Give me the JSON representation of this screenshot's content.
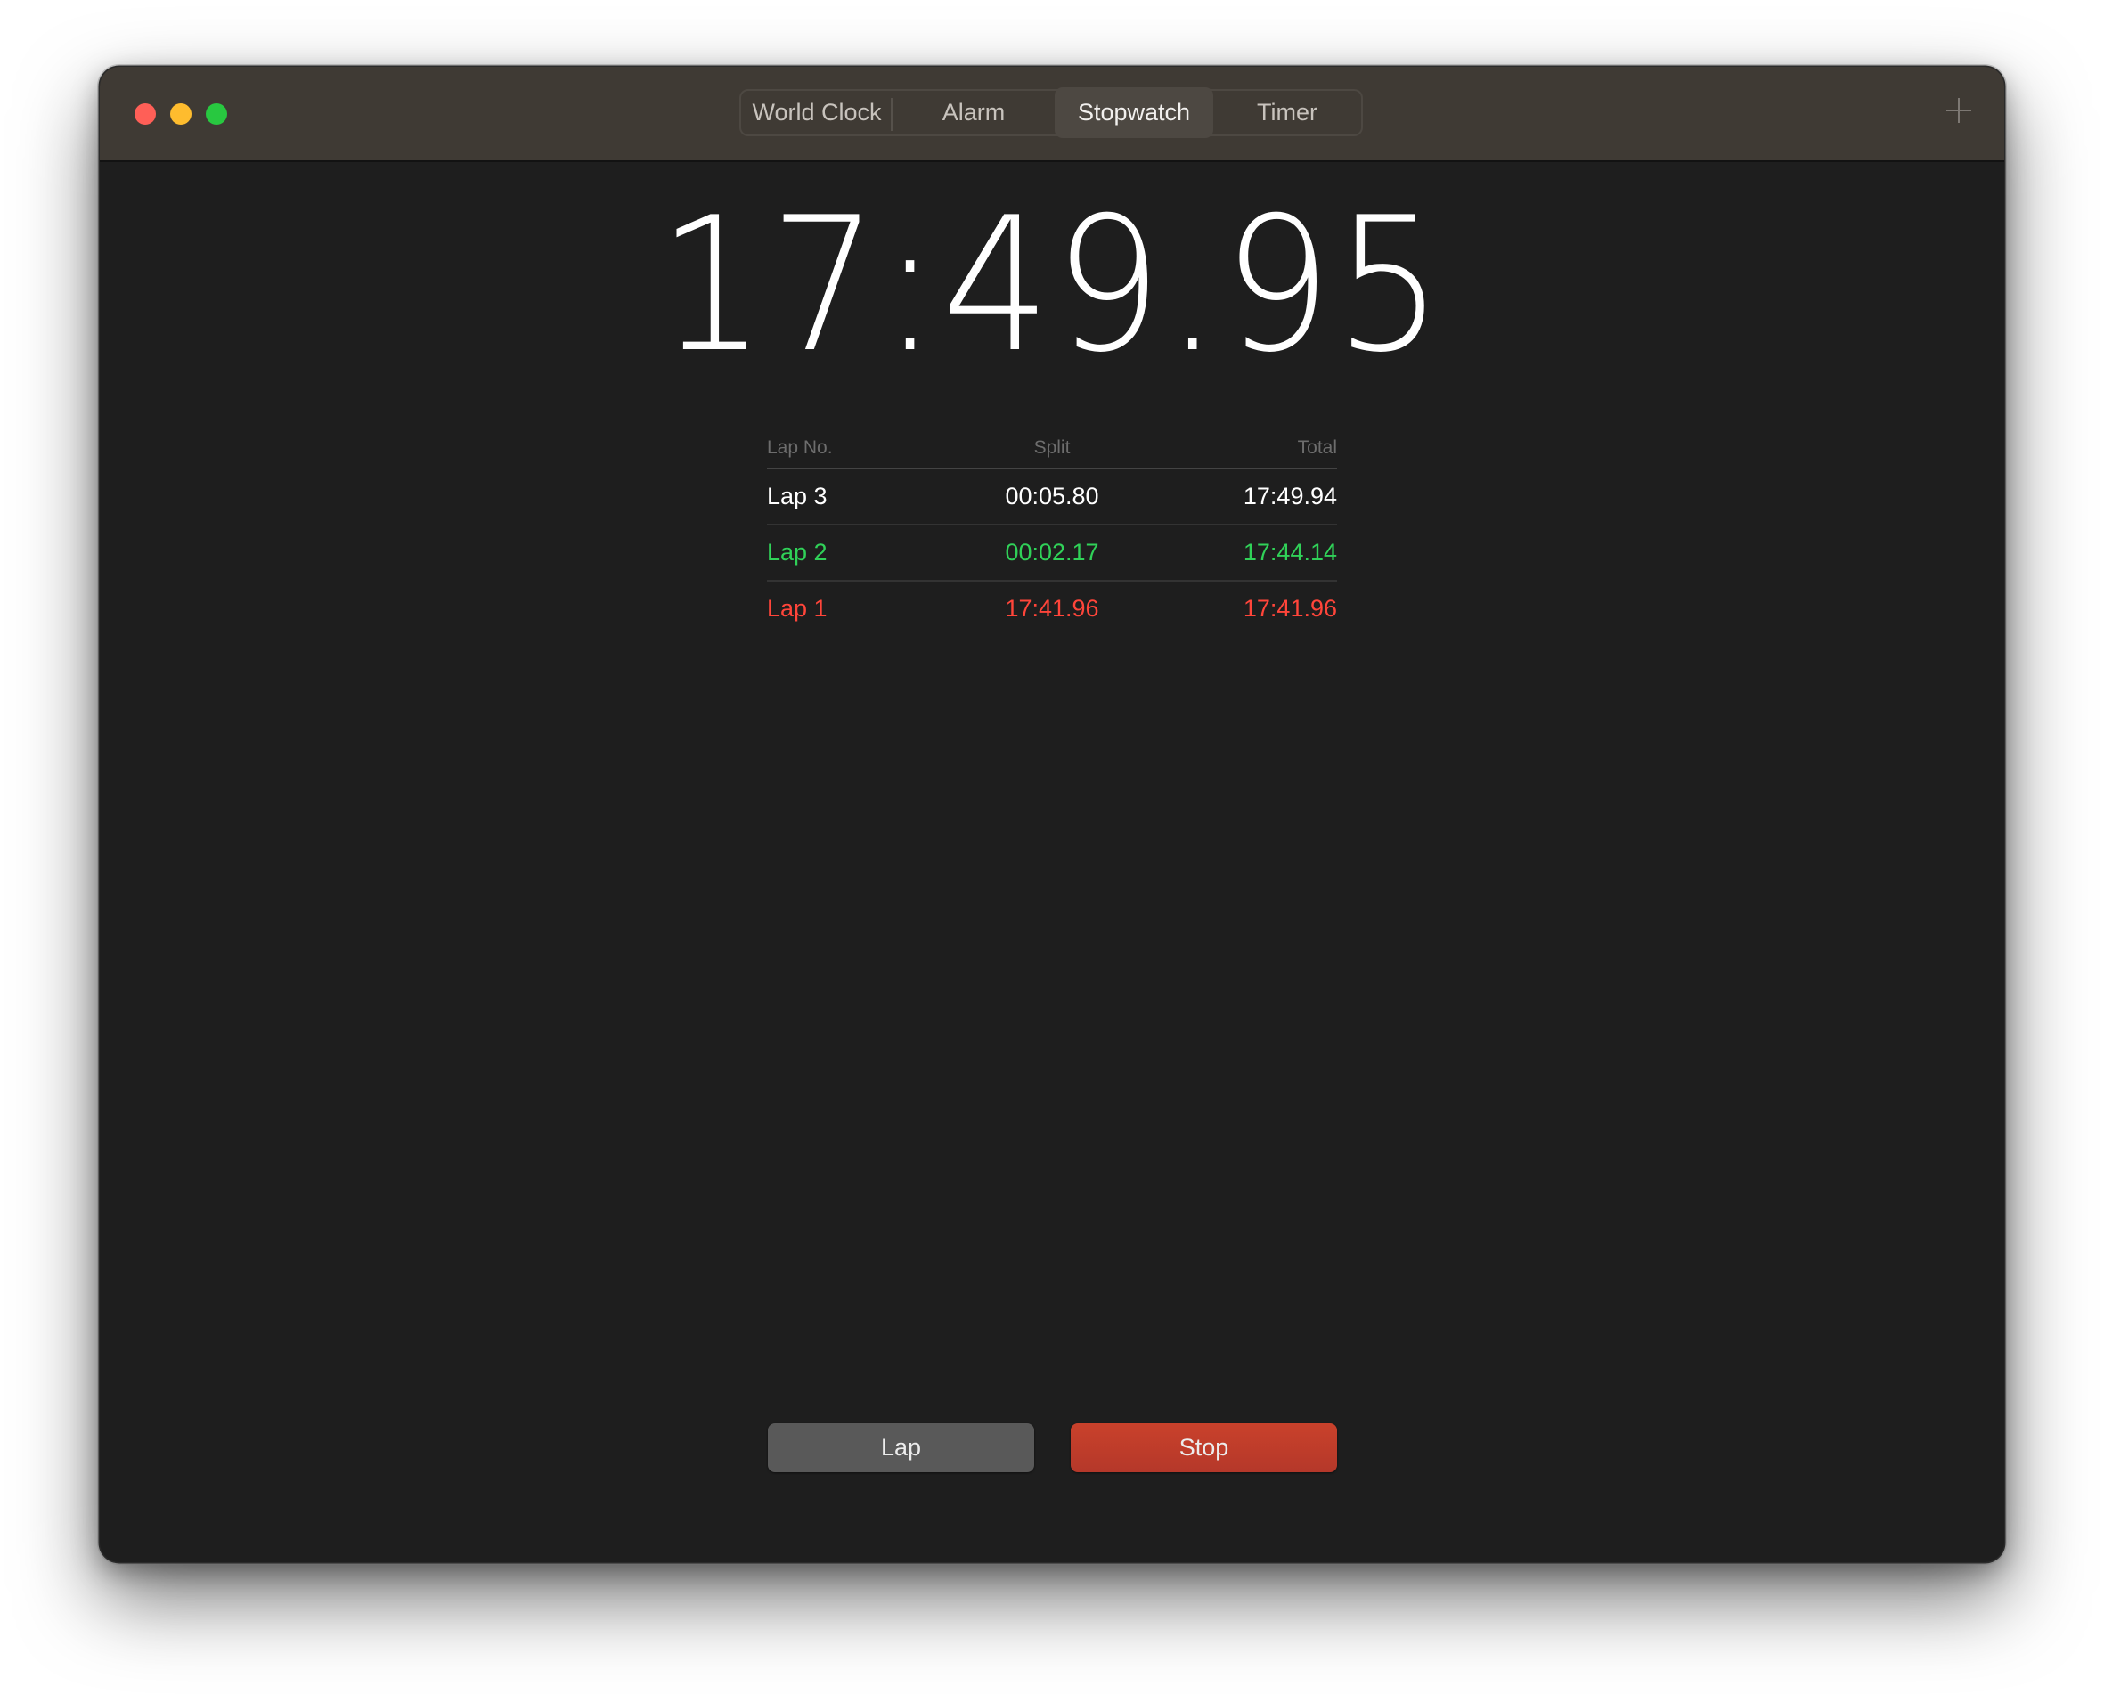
{
  "window": {
    "traffic_lights": [
      {
        "name": "close",
        "color": "#ff5f57"
      },
      {
        "name": "minimize",
        "color": "#febc2e"
      },
      {
        "name": "zoom",
        "color": "#28c840"
      }
    ],
    "add_icon": "plus-icon"
  },
  "tabs": [
    {
      "label": "World Clock",
      "selected": false
    },
    {
      "label": "Alarm",
      "selected": false
    },
    {
      "label": "Stopwatch",
      "selected": true
    },
    {
      "label": "Timer",
      "selected": false
    }
  ],
  "stopwatch": {
    "display": "17:49.95",
    "columns": {
      "lap": "Lap No.",
      "split": "Split",
      "total": "Total"
    },
    "laps": [
      {
        "lap": "Lap 3",
        "split": "00:05.80",
        "total": "17:49.94",
        "status": "normal",
        "color": "#ffffff"
      },
      {
        "lap": "Lap 2",
        "split": "00:02.17",
        "total": "17:44.14",
        "status": "fastest",
        "color": "#30d158"
      },
      {
        "lap": "Lap 1",
        "split": "17:41.96",
        "total": "17:41.96",
        "status": "slowest",
        "color": "#ff453a"
      }
    ]
  },
  "buttons": {
    "lap_label": "Lap",
    "stop_label": "Stop",
    "stop_color": "#c43f2b"
  }
}
